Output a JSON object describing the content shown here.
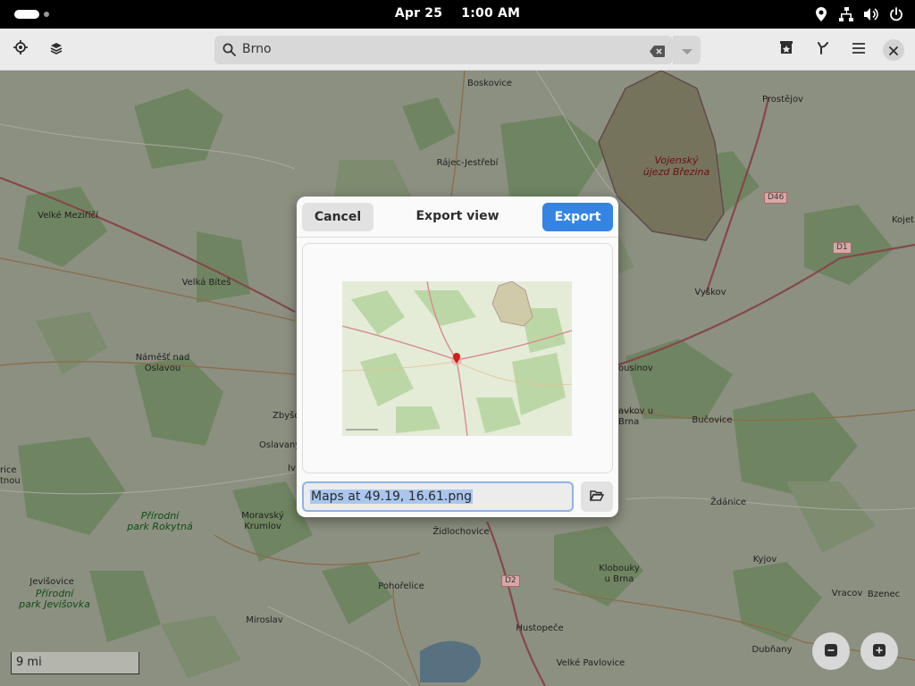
{
  "topbar": {
    "date": "Apr 25",
    "time": "1:00 AM",
    "tray_icons": [
      "location-icon",
      "network-icon",
      "volume-icon",
      "power-icon"
    ]
  },
  "header": {
    "search_value": "Brno",
    "buttons": [
      "locate-icon",
      "layers-icon",
      "favorites-icon",
      "route-icon",
      "menu-icon",
      "close-icon"
    ]
  },
  "map": {
    "places": {
      "boskovice": "Boskovice",
      "prostejov": "Prostějov",
      "rajec": "Rájec-Jestřebí",
      "vojensky": "Vojenský",
      "ujezd": "újezd Březina",
      "velke_mezirici": "Velké Meziříčí",
      "kojet": "Kojet",
      "velka_bites": "Velká Bíteš",
      "vyskov": "Vyškov",
      "namest1": "Náměšť nad",
      "namest2": "Oslavou",
      "kousinov": "ousínov",
      "slavkov1": "avkov u",
      "slavkov2": "Brna",
      "bucovice": "Bučovice",
      "zbyso": "Zbyšo",
      "oslavany": "Oslavany",
      "ivice": "Iv",
      "rice": "rice",
      "tnou": "tnou",
      "zdanice": "Ždánice",
      "moravsky1": "Moravský",
      "moravsky2": "Krumlov",
      "zidlochovice": "Židlochovice",
      "prirodni_rokytna1": "Přírodní",
      "prirodni_rokytna2": "park Rokytná",
      "klobouky1": "Klobouky",
      "klobouky2": "u Brna",
      "kyjov": "Kyjov",
      "jevisovice": "Jevišovice",
      "prirodni_jev1": "Přírodní",
      "prirodni_jev2": "park Jevišovka",
      "pohorelice": "Pohořelice",
      "vracov": "Vracov",
      "bzenec": "Bzenec",
      "miroslav": "Miroslav",
      "hustopece": "Hustopeče",
      "dubnany": "Dubňany",
      "velke_pavlovice": "Velké Pavlovice"
    },
    "road_shields": {
      "d46": "D46",
      "d1": "D1",
      "d2": "D2"
    },
    "scale_label": "9 mi",
    "zoom_out_icon": "zoom-out-icon",
    "zoom_in_icon": "zoom-in-icon"
  },
  "dialog": {
    "cancel_label": "Cancel",
    "title": "Export view",
    "export_label": "Export",
    "filename": "Maps at 49.19, 16.61.png",
    "folder_icon": "folder-open-icon"
  },
  "colors": {
    "accent": "#3584e4",
    "topbar": "#000000",
    "headerbar": "#ebebeb",
    "dialog_bg": "#fafafa"
  }
}
